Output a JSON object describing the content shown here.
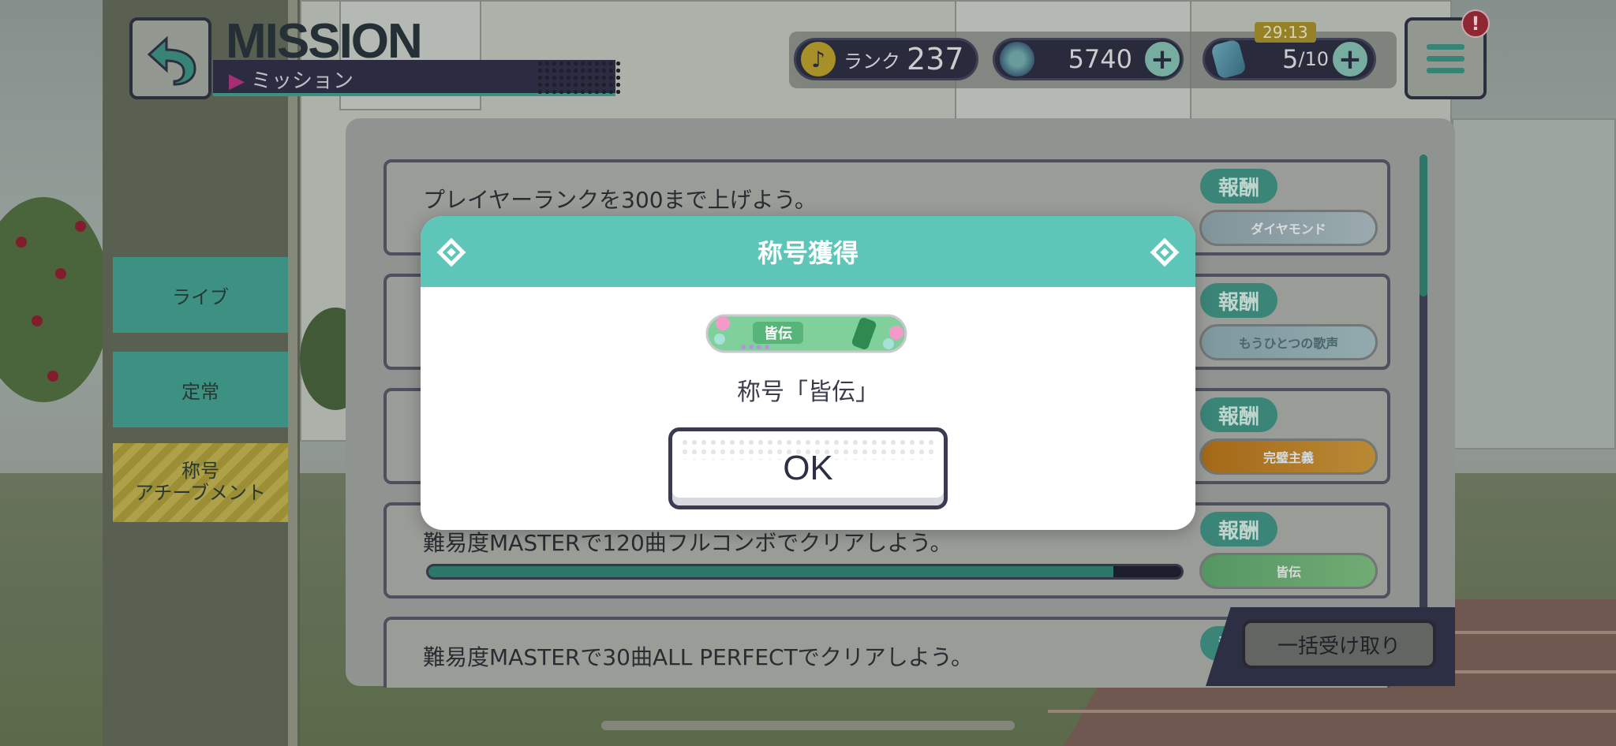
{
  "header": {
    "title_en": "MISSION",
    "title_jp": "ミッション",
    "rank_label": "ランク",
    "rank_value": "237",
    "gem_value": "5740",
    "stamina_value": "5",
    "stamina_max": "/10",
    "timer": "29:13",
    "alert": "!"
  },
  "nav": {
    "live": "ライブ",
    "constant": "定常",
    "title_line1": "称号",
    "title_line2": "アチーブメント"
  },
  "missions": [
    {
      "text": "プレイヤーランクを300まで上げよう。",
      "reward_label": "報酬",
      "reward_plate": "ダイヤモンド"
    },
    {
      "text": "",
      "reward_label": "報酬",
      "reward_plate": "もうひとつの歌声"
    },
    {
      "text": "",
      "reward_label": "報酬",
      "reward_plate": "完璧主義"
    },
    {
      "text": "難易度MASTERで120曲フルコンボでクリアしよう。",
      "reward_label": "報酬",
      "reward_plate": "皆伝",
      "progress": 0.91
    },
    {
      "text": "難易度MASTERで30曲ALL PERFECTでクリアしよう。",
      "reward_label": "報酬"
    }
  ],
  "claim_all": "一括受け取り",
  "modal": {
    "title": "称号獲得",
    "badge_text": "皆伝",
    "name": "称号「皆伝」",
    "ok": "OK"
  },
  "colors": {
    "accent": "#5ec6b8",
    "dark": "#2d2d45",
    "reward_green": "#3e8e80"
  }
}
